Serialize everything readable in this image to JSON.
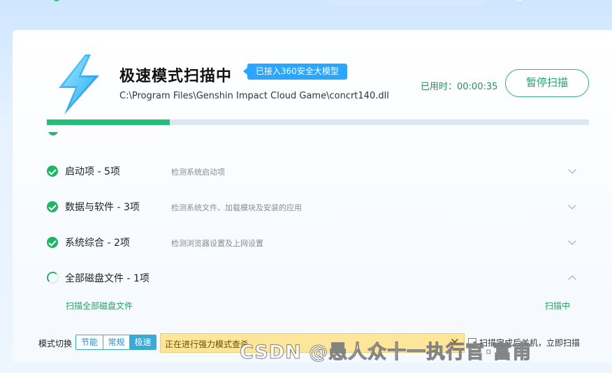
{
  "scan": {
    "title": "极速模式扫描中",
    "badge": "已接入360安全大模型",
    "path": "C:\\Program Files\\Genshin Impact Cloud Game\\concrt140.dll",
    "elapsed": "已用时：00:00:35",
    "pause_label": "暂停扫描",
    "progress": 0.227
  },
  "items": [
    {
      "title": "启动项 -  5项",
      "desc": "检测系统启动项",
      "status": "done",
      "expanded": false
    },
    {
      "title": "数据与软件 -  3项",
      "desc": "检测系统文件、加载模块及安装的应用",
      "status": "done",
      "expanded": false
    },
    {
      "title": "系统综合 -  2项",
      "desc": "检测浏览器设置及上网设置",
      "status": "done",
      "expanded": false
    },
    {
      "title": "全部磁盘文件 -  1项",
      "desc": "",
      "status": "scanning",
      "expanded": true
    }
  ],
  "subitem": {
    "label": "扫描全部磁盘文件",
    "status": "扫描中"
  },
  "mode": {
    "label": "模式切换",
    "options": [
      "节能",
      "常规",
      "极速"
    ],
    "selected": "极速"
  },
  "notice": {
    "text": "正在进行强力模式查杀",
    "close": "✕"
  },
  "shutdown": {
    "label": "扫描完成后关机，立即扫描"
  },
  "watermark": "CSDN @愚人众十一执行官·富甫",
  "colors": {
    "accent": "#1fb567",
    "badge": "#2aa6ff",
    "notice_bg": "#fde59a"
  }
}
